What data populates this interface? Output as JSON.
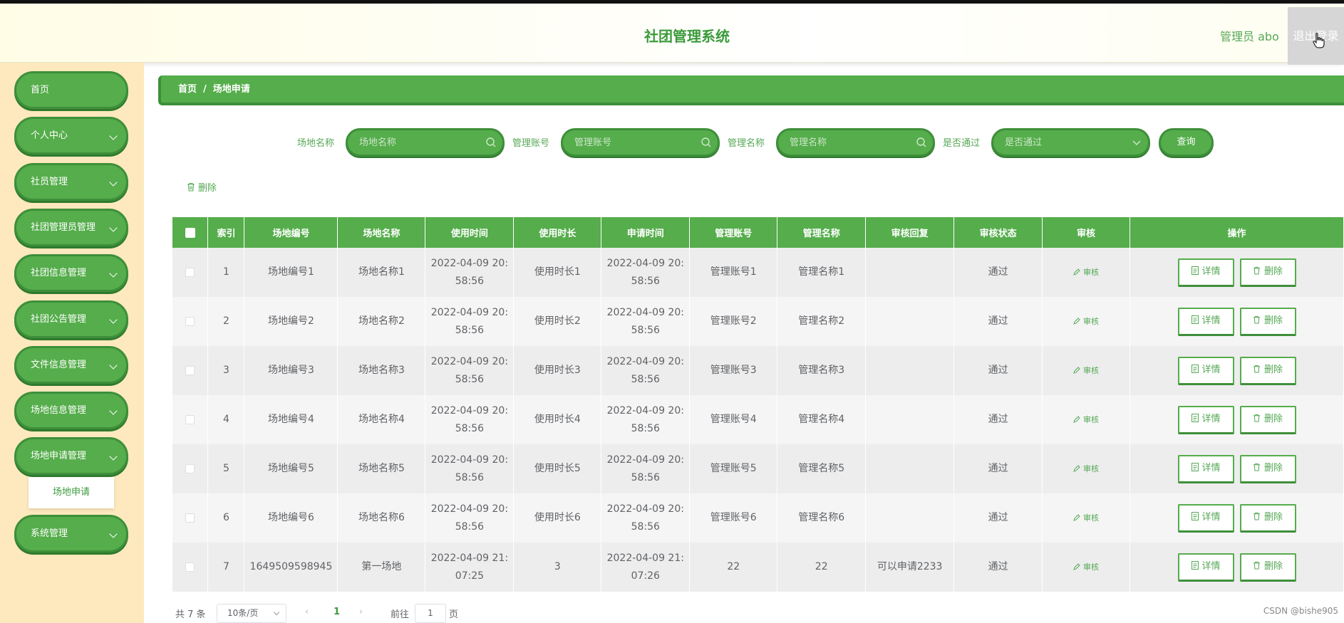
{
  "header": {
    "title": "社团管理系统",
    "admin": "管理员 abo",
    "logout": "退出登录"
  },
  "sidebar": {
    "items": [
      {
        "label": "首页",
        "has_chevron": false
      },
      {
        "label": "个人中心",
        "has_chevron": true
      },
      {
        "label": "社员管理",
        "has_chevron": true
      },
      {
        "label": "社团管理员管理",
        "has_chevron": true
      },
      {
        "label": "社团信息管理",
        "has_chevron": true
      },
      {
        "label": "社团公告管理",
        "has_chevron": true
      },
      {
        "label": "文件信息管理",
        "has_chevron": true
      },
      {
        "label": "场地信息管理",
        "has_chevron": true
      },
      {
        "label": "场地申请管理",
        "has_chevron": true
      },
      {
        "label": "系统管理",
        "has_chevron": true
      }
    ],
    "submenu_item": "场地申请"
  },
  "breadcrumb": {
    "home": "首页",
    "sep": "/",
    "current": "场地申请"
  },
  "search": {
    "venue_name_label": "场地名称",
    "venue_name_placeholder": "场地名称",
    "account_label": "管理账号",
    "account_placeholder": "管理账号",
    "manager_name_label": "管理名称",
    "manager_name_placeholder": "管理名称",
    "passed_label": "是否通过",
    "passed_placeholder": "是否通过",
    "query_button": "查询"
  },
  "toolbar": {
    "delete_label": "删除"
  },
  "table": {
    "headers": [
      "",
      "索引",
      "场地编号",
      "场地名称",
      "使用时间",
      "使用时长",
      "申请时间",
      "管理账号",
      "管理名称",
      "审核回复",
      "审核状态",
      "审核",
      "操作"
    ],
    "audit_label": "审核",
    "detail_label": "详情",
    "delete_label": "删除",
    "rows": [
      {
        "index": "1",
        "venue_no": "场地编号1",
        "venue_name": "场地名称1",
        "use_time_1": "2022-04-09 20:",
        "use_time_2": "58:56",
        "duration": "使用时长1",
        "apply_time_1": "2022-04-09 20:",
        "apply_time_2": "58:56",
        "account": "管理账号1",
        "manager": "管理名称1",
        "reply": "",
        "status": "通过"
      },
      {
        "index": "2",
        "venue_no": "场地编号2",
        "venue_name": "场地名称2",
        "use_time_1": "2022-04-09 20:",
        "use_time_2": "58:56",
        "duration": "使用时长2",
        "apply_time_1": "2022-04-09 20:",
        "apply_time_2": "58:56",
        "account": "管理账号2",
        "manager": "管理名称2",
        "reply": "",
        "status": "通过"
      },
      {
        "index": "3",
        "venue_no": "场地编号3",
        "venue_name": "场地名称3",
        "use_time_1": "2022-04-09 20:",
        "use_time_2": "58:56",
        "duration": "使用时长3",
        "apply_time_1": "2022-04-09 20:",
        "apply_time_2": "58:56",
        "account": "管理账号3",
        "manager": "管理名称3",
        "reply": "",
        "status": "通过"
      },
      {
        "index": "4",
        "venue_no": "场地编号4",
        "venue_name": "场地名称4",
        "use_time_1": "2022-04-09 20:",
        "use_time_2": "58:56",
        "duration": "使用时长4",
        "apply_time_1": "2022-04-09 20:",
        "apply_time_2": "58:56",
        "account": "管理账号4",
        "manager": "管理名称4",
        "reply": "",
        "status": "通过"
      },
      {
        "index": "5",
        "venue_no": "场地编号5",
        "venue_name": "场地名称5",
        "use_time_1": "2022-04-09 20:",
        "use_time_2": "58:56",
        "duration": "使用时长5",
        "apply_time_1": "2022-04-09 20:",
        "apply_time_2": "58:56",
        "account": "管理账号5",
        "manager": "管理名称5",
        "reply": "",
        "status": "通过"
      },
      {
        "index": "6",
        "venue_no": "场地编号6",
        "venue_name": "场地名称6",
        "use_time_1": "2022-04-09 20:",
        "use_time_2": "58:56",
        "duration": "使用时长6",
        "apply_time_1": "2022-04-09 20:",
        "apply_time_2": "58:56",
        "account": "管理账号6",
        "manager": "管理名称6",
        "reply": "",
        "status": "通过"
      },
      {
        "index": "7",
        "venue_no": "1649509598945",
        "venue_name": "第一场地",
        "use_time_1": "2022-04-09 21:",
        "use_time_2": "07:25",
        "duration": "3",
        "apply_time_1": "2022-04-09 21:",
        "apply_time_2": "07:26",
        "account": "22",
        "manager": "22",
        "reply": "可以申请2233",
        "status": "通过"
      }
    ]
  },
  "pagination": {
    "total": "共 7 条",
    "page_size": "10条/页",
    "current_page": "1",
    "goto_label": "前往",
    "goto_value": "1",
    "page_suffix": "页"
  },
  "watermark": "CSDN @bishe905"
}
